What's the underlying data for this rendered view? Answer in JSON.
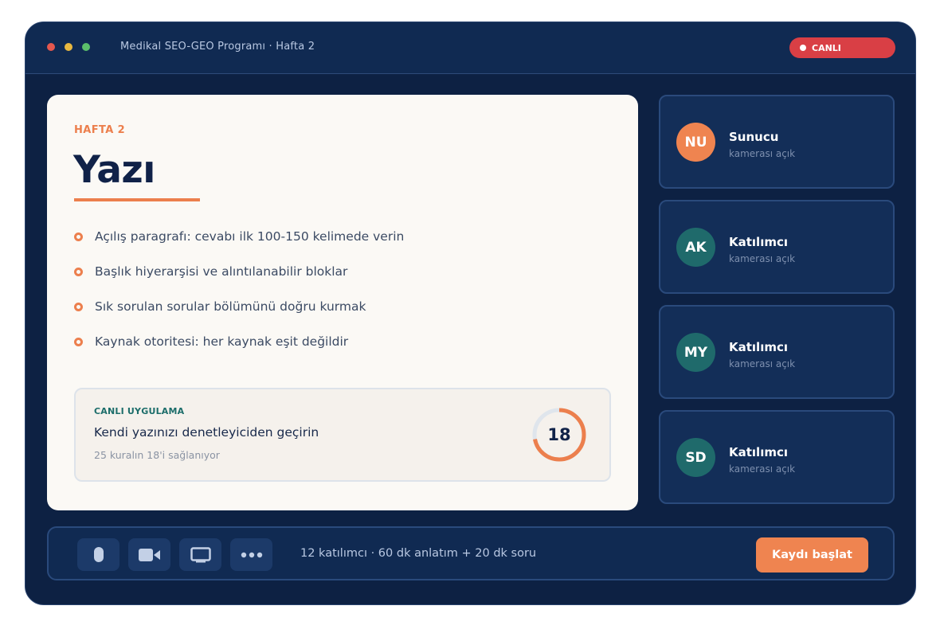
{
  "window": {
    "title": "Medikal SEO-GEO Programı · Hafta 2",
    "live_label": "CANLI",
    "live_color": "#d93f45"
  },
  "slide": {
    "eyebrow": "HAFTA 2",
    "title": "Yazı",
    "bullets": [
      "Açılış paragrafı: cevabı ilk 100-150 kelimede verin",
      "Başlık hiyerarşisi ve alıntılanabilir bloklar",
      "Sık sorulan sorular bölümünü doğru kurmak",
      "Kaynak otoritesi: her kaynak eşit değildir"
    ],
    "practice": {
      "label": "CANLI UYGULAMA",
      "title": "Kendi yazınızı denetleyiciden geçirin",
      "subtitle": "25 kuralın 18'i sağlanıyor",
      "score": "18",
      "progress_fraction": 0.72,
      "accent": "#ec7f4d"
    }
  },
  "participants": [
    {
      "initials": "NU",
      "role": "Sunucu",
      "status": "kamerası açık",
      "color": "#ef8450"
    },
    {
      "initials": "AK",
      "role": "Katılımcı",
      "status": "kamerası açık",
      "color": "#1f6a6b"
    },
    {
      "initials": "MY",
      "role": "Katılımcı",
      "status": "kamerası açık",
      "color": "#1f6a6b"
    },
    {
      "initials": "SD",
      "role": "Katılımcı",
      "status": "kamerası açık",
      "color": "#1f6a6b"
    }
  ],
  "toolbar": {
    "tools": [
      {
        "name": "microphone-icon"
      },
      {
        "name": "camera-icon"
      },
      {
        "name": "screen-share-icon"
      },
      {
        "name": "more-icon"
      }
    ],
    "info": "12 katılımcı · 60 dk anlatım + 20 dk soru",
    "record_label": "Kaydı başlat"
  }
}
